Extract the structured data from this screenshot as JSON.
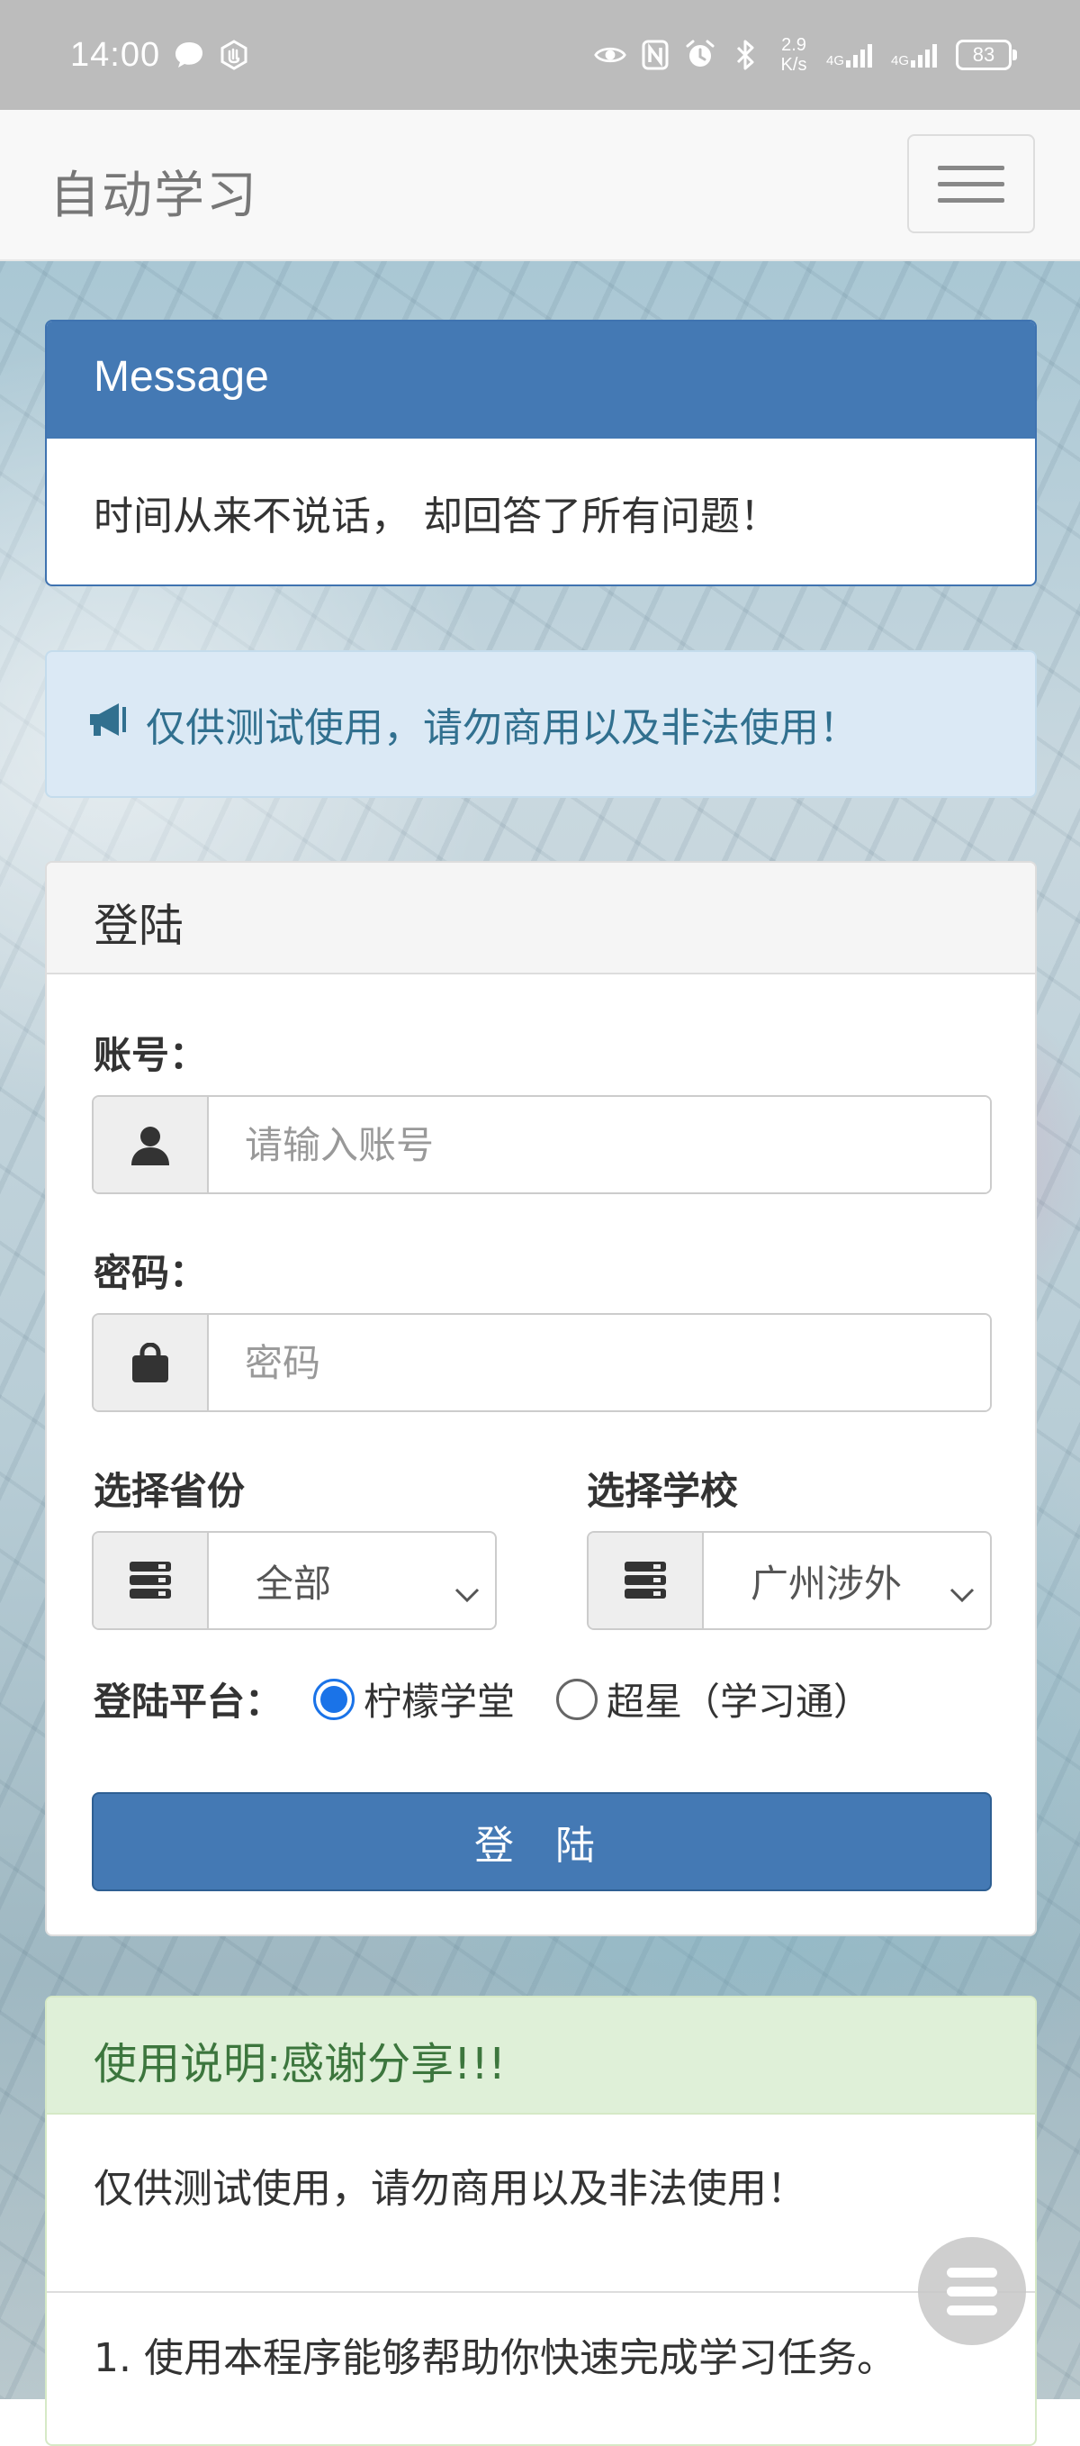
{
  "status_bar": {
    "time": "14:00",
    "speed": "2.9",
    "speed_unit": "K/s",
    "net1": "4G",
    "net2": "4G",
    "battery": "83"
  },
  "navbar": {
    "brand": "自动学习"
  },
  "message_panel": {
    "title": "Message",
    "body": "时间从来不说话， 却回答了所有问题！"
  },
  "notice": {
    "text": "仅供测试使用，请勿商用以及非法使用！"
  },
  "login_panel": {
    "title": "登陆",
    "account_label": "账号：",
    "account_placeholder": "请输入账号",
    "password_label": "密码：",
    "password_placeholder": "密码",
    "province_label": "选择省份",
    "province_value": "全部",
    "school_label": "选择学校",
    "school_value": "广州涉外",
    "platform_label": "登陆平台：",
    "platform_options": [
      "柠檬学堂",
      "超星（学习通）"
    ],
    "platform_selected": "柠檬学堂",
    "submit_label": "登 陆"
  },
  "usage_panel": {
    "title": "使用说明:感谢分享!!!",
    "line1": "仅供测试使用，请勿商用以及非法使用！",
    "item1": "1. 使用本程序能够帮助你快速完成学习任务。"
  },
  "colors": {
    "primary": "#4479b4",
    "info_bg": "#dbe9f5",
    "info_text": "#31708f",
    "success_bg": "#dff0d8",
    "success_text": "#3c763d",
    "radio_checked": "#1a73e8"
  },
  "icons": {
    "account": "user-icon",
    "password": "lock-icon",
    "select": "server-list-icon",
    "notice": "bullhorn-icon",
    "menu": "hamburger-menu-icon"
  }
}
